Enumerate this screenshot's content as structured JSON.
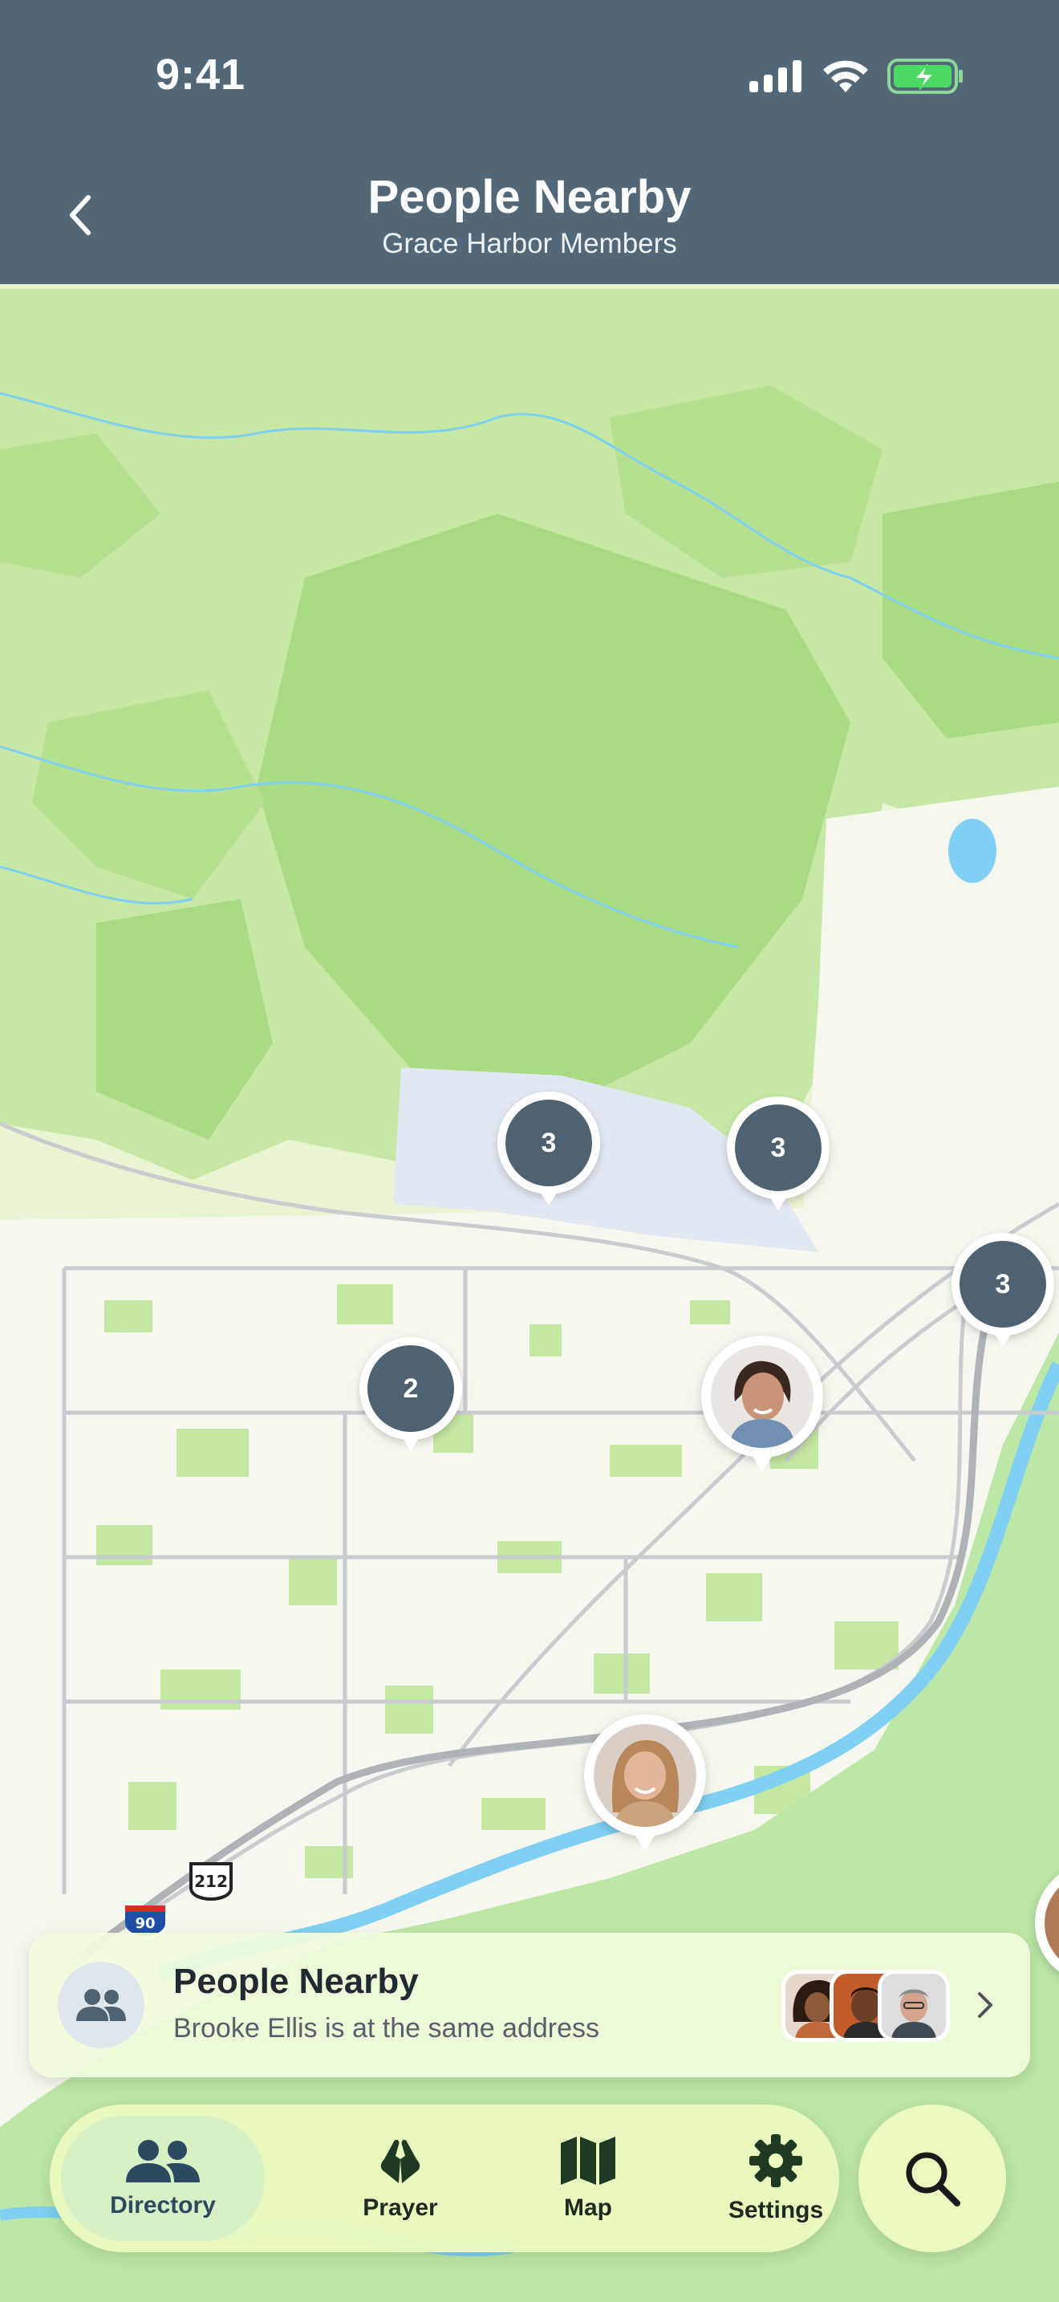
{
  "status_bar": {
    "time": "9:41"
  },
  "header": {
    "title": "People Nearby",
    "subtitle": "Grace Harbor Members"
  },
  "map": {
    "clusters": [
      {
        "count": "3"
      },
      {
        "count": "3"
      },
      {
        "count": "3"
      },
      {
        "count": "2"
      }
    ],
    "road_shields": {
      "interstate": "90",
      "us_route": "212"
    }
  },
  "nearby_card": {
    "title": "People Nearby",
    "subtitle": "Brooke Ellis is at the same address"
  },
  "tabs": [
    {
      "label": "Directory",
      "icon": "people-icon",
      "active": true
    },
    {
      "label": "Prayer",
      "icon": "praying-hands-icon",
      "active": false
    },
    {
      "label": "Map",
      "icon": "map-icon",
      "active": false
    },
    {
      "label": "Settings",
      "icon": "gear-icon",
      "active": false
    }
  ],
  "colors": {
    "header": "#526878",
    "cluster": "#4f6272",
    "map_green": "#b9e49a",
    "map_light": "#f7f7ee",
    "water": "#7fd0f2",
    "tabbar": "#ecfabe"
  }
}
